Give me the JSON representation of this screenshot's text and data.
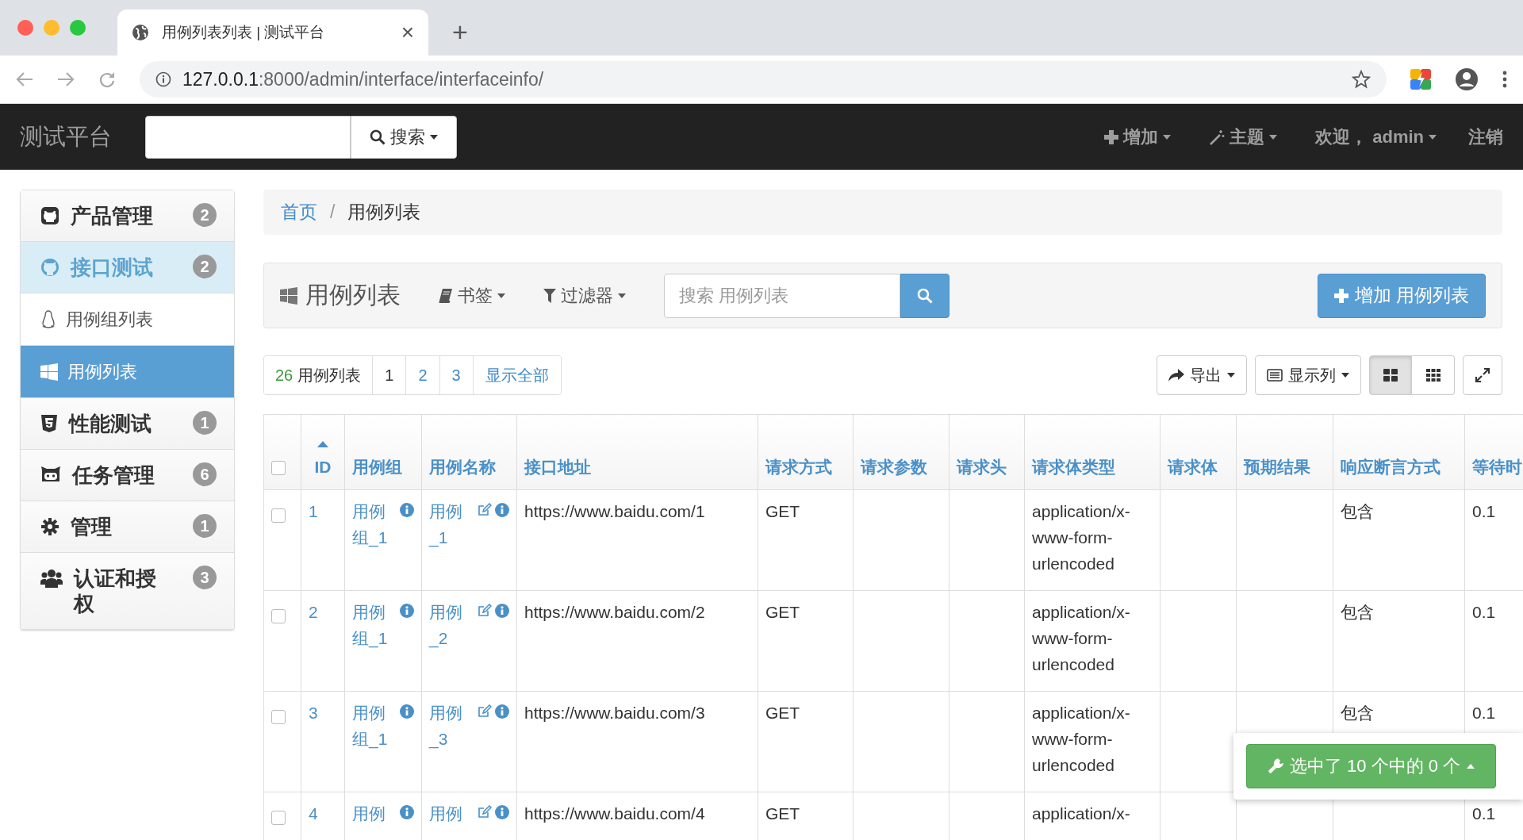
{
  "browser": {
    "tab_title": "用例列表列表 | 测试平台",
    "tab_close": "×",
    "new_tab": "+",
    "url_host": "127.0.0.1",
    "url_path": ":8000/admin/interface/interfaceinfo/"
  },
  "navbar": {
    "brand": "测试平台",
    "search_button": "搜索",
    "menus": [
      {
        "label": "增加"
      },
      {
        "label": "主题"
      }
    ],
    "welcome": "欢迎，",
    "username": "admin",
    "logout": "注销"
  },
  "sidebar": {
    "items": [
      {
        "label": "产品管理",
        "badge": "2",
        "selected": false,
        "expanded": false
      },
      {
        "label": "接口测试",
        "badge": "2",
        "selected": false,
        "expanded": true,
        "children": [
          {
            "label": "用例组列表",
            "selected": false
          },
          {
            "label": "用例列表",
            "selected": true
          }
        ]
      },
      {
        "label": "性能测试",
        "badge": "1",
        "selected": false,
        "expanded": false
      },
      {
        "label": "任务管理",
        "badge": "6",
        "selected": false,
        "expanded": false
      },
      {
        "label": "管理",
        "badge": "1",
        "selected": false,
        "expanded": false
      },
      {
        "label": "认证和授权",
        "badge": "3",
        "selected": false,
        "expanded": false
      }
    ]
  },
  "breadcrumb": [
    {
      "label": "首页",
      "active": false
    },
    {
      "label": "用例列表",
      "active": true
    }
  ],
  "breadcrumb_separator": "/",
  "panel": {
    "title": "用例列表",
    "bookmarks": "书签",
    "filter": "过滤器",
    "search_placeholder": "搜索 用例列表",
    "add_button": "增加 用例列表"
  },
  "pagination": {
    "count": "26",
    "count_label": "用例列表",
    "pages": [
      {
        "label": "1",
        "selected": true
      },
      {
        "label": "2",
        "selected": false
      },
      {
        "label": "3",
        "selected": false
      }
    ],
    "show_all": "显示全部"
  },
  "tools": {
    "export": "导出",
    "columns": "显示列",
    "views": [
      {
        "selected": true
      },
      {
        "selected": false
      }
    ]
  },
  "table": {
    "select_all_checked": false,
    "columns": [
      {
        "label": "ID",
        "sorted": true
      },
      {
        "label": "用例组",
        "sorted": false
      },
      {
        "label": "用例名称",
        "sorted": false
      },
      {
        "label": "接口地址",
        "sorted": false
      },
      {
        "label": "请求方式",
        "sorted": false
      },
      {
        "label": "请求参数",
        "sorted": false
      },
      {
        "label": "请求头",
        "sorted": false
      },
      {
        "label": "请求体类型",
        "sorted": false
      },
      {
        "label": "请求体",
        "sorted": false
      },
      {
        "label": "预期结果",
        "sorted": false
      },
      {
        "label": "响应断言方式",
        "sorted": false
      },
      {
        "label": "等待时",
        "sorted": false
      }
    ],
    "rows": [
      {
        "checked": false,
        "id": "1",
        "group": "用例组_1",
        "name": "用例_1",
        "url": "https://www.baidu.com/1",
        "method": "GET",
        "body_type": "application/x-www-form-urlencoded",
        "assertion": "包含",
        "wait": "0.1"
      },
      {
        "checked": false,
        "id": "2",
        "group": "用例组_1",
        "name": "用例_2",
        "url": "https://www.baidu.com/2",
        "method": "GET",
        "body_type": "application/x-www-form-urlencoded",
        "assertion": "包含",
        "wait": "0.1"
      },
      {
        "checked": false,
        "id": "3",
        "group": "用例组_1",
        "name": "用例_3",
        "url": "https://www.baidu.com/3",
        "method": "GET",
        "body_type": "application/x-www-form-urlencoded",
        "assertion": "包含",
        "wait": "0.1"
      },
      {
        "checked": false,
        "id": "4",
        "group": "用例",
        "name": "用例",
        "url": "https://www.baidu.com/4",
        "method": "GET",
        "body_type": "application/x-",
        "wait": "0.1"
      }
    ]
  },
  "action_bar": {
    "label": "选中了 10 个中的 0 个"
  }
}
